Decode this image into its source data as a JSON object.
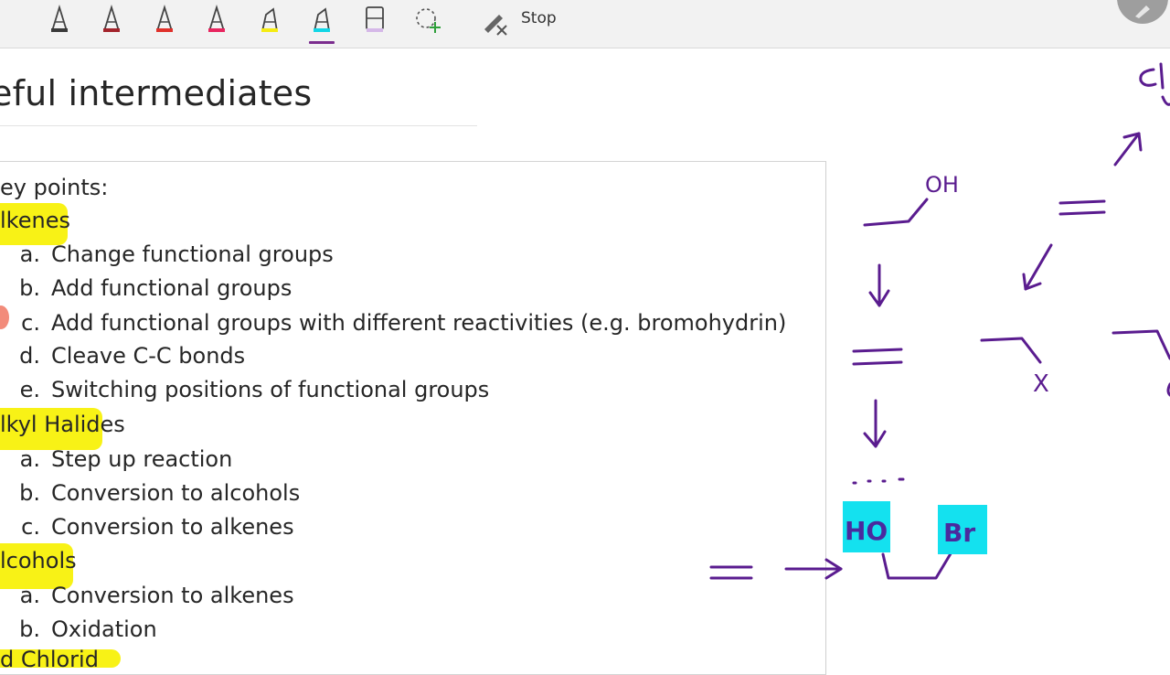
{
  "toolbar": {
    "tools": [
      {
        "name": "pen-black-tool",
        "color": "#3a3a3a"
      },
      {
        "name": "pen-dark-red-tool",
        "color": "#a3242c"
      },
      {
        "name": "pen-red-tool",
        "color": "#e0312b"
      },
      {
        "name": "pen-pink-tool",
        "color": "#e8255f"
      },
      {
        "name": "highlighter-yellow-tool",
        "color": "#f5ec13"
      },
      {
        "name": "highlighter-cyan-tool",
        "color": "#12d6e6"
      },
      {
        "name": "highlighter-lavender-tool",
        "color": "#d5b8e8"
      },
      {
        "name": "lasso-select-tool",
        "color": "#2e9f3a"
      }
    ],
    "selected_tool": "highlighter-cyan-tool",
    "stop_label": "Stop"
  },
  "page": {
    "title": "eful intermediates",
    "key_points": "ey points:",
    "sections": [
      {
        "heading": "lkenes",
        "items": [
          {
            "label": "a.",
            "text": "Change functional groups"
          },
          {
            "label": "b.",
            "text": "Add functional groups"
          },
          {
            "label": "c.",
            "text": "Add functional groups with different reactivities (e.g. bromohydrin)"
          },
          {
            "label": "d.",
            "text": "Cleave C-C bonds"
          },
          {
            "label": "e.",
            "text": "Switching positions of functional groups"
          }
        ]
      },
      {
        "heading": "lkyl Halides",
        "items": [
          {
            "label": "a.",
            "text": "Step up reaction"
          },
          {
            "label": "b.",
            "text": "Conversion to alcohols"
          },
          {
            "label": "c.",
            "text": "Conversion to alkenes"
          }
        ]
      },
      {
        "heading": "lcohols",
        "items": [
          {
            "label": "a.",
            "text": "Conversion to alkenes"
          },
          {
            "label": "b.",
            "text": "Oxidation"
          }
        ]
      }
    ],
    "cut_off_heading": "d Chlorid"
  },
  "ink": {
    "color": "#5a1c8f",
    "highlight_color": "#14e1ef",
    "labels": {
      "oh": "OH",
      "x": "X",
      "ho": "HO",
      "br": "Br",
      "cl": "Cl"
    }
  }
}
